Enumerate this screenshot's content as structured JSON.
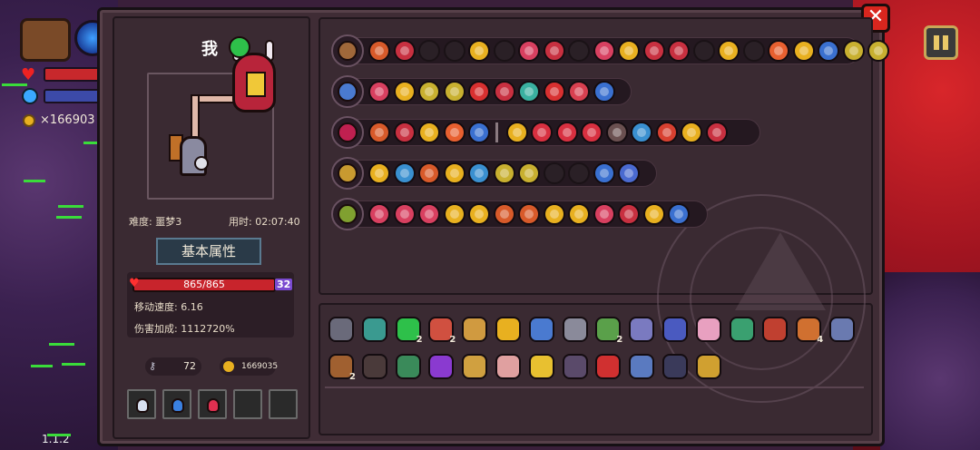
{
  "hud": {
    "gold": "×166903",
    "version": "1.1.2"
  },
  "character": {
    "name": "我",
    "difficulty": "难度: 噩梦3",
    "time_played": "用时: 02:07:40",
    "section_title": "基本属性",
    "hp": "865/865",
    "hp_max_badge": "32",
    "move_speed": "移动速度: 6.16",
    "damage_bonus": "伤害加成: 1112720%",
    "keys": "72",
    "coins": "1669035"
  },
  "colors": {
    "accent": "#c8a858",
    "hp": "#c8242c",
    "close": "#d8261e"
  },
  "card_rows": [
    {
      "weapon_color": "#a0683a",
      "chips": [
        "#d85a2a",
        "#c83040",
        "",
        "",
        "#e8b020",
        "",
        "#d84060",
        "#c83040",
        "",
        "#d84060",
        "#e8b020",
        "#c83040",
        "#c83040",
        "",
        "#e8b020",
        "",
        "#e86030",
        "#e8b020",
        "#3a70d0",
        "#c8b030",
        "#c8b030"
      ]
    },
    {
      "weapon_color": "#4a7ad0",
      "chips": [
        "#d84060",
        "#e8b020",
        "#c8b030",
        "#c8b030",
        "#d83030",
        "#c83040",
        "#3ab0a0",
        "#d83030",
        "#d84050",
        "#3a70d0"
      ]
    },
    {
      "weapon_color": "#c02050",
      "chips": [
        "#d85a2a",
        "#c83040",
        "#e8b020",
        "#e86030",
        "#3a70d0",
        "|",
        "#e8b020",
        "#d83040",
        "#d83040",
        "#d83040",
        "#6a5050",
        "#3a90d0",
        "#d84030",
        "#e8b020",
        "#c83040"
      ]
    },
    {
      "weapon_color": "#c89a30",
      "chips": [
        "#e8b020",
        "#3a90d0",
        "#d85a2a",
        "#e8b020",
        "#3a90d0",
        "#c8b030",
        "#c8b030",
        "",
        "",
        "#3a70d0",
        "#4a6ad0"
      ]
    },
    {
      "weapon_color": "#80a030",
      "chips": [
        "#d84060",
        "#d84060",
        "#d84060",
        "#e8b020",
        "#e8b020",
        "#d85a2a",
        "#d85a2a",
        "#e8b020",
        "#e8b020",
        "#d84060",
        "#c83040",
        "#e8b020",
        "#3a70d0"
      ]
    }
  ],
  "items": {
    "row1": [
      {
        "color": "#6a6a7a",
        "count": ""
      },
      {
        "color": "#3a9a90",
        "count": ""
      },
      {
        "color": "#2ec04a",
        "count": "2"
      },
      {
        "color": "#d05040",
        "count": "2"
      },
      {
        "color": "#d09a40",
        "count": ""
      },
      {
        "color": "#e8b020",
        "count": ""
      },
      {
        "color": "#4a7ad0",
        "count": ""
      },
      {
        "color": "#8a8a9a",
        "count": ""
      },
      {
        "color": "#5aa04a",
        "count": "2"
      },
      {
        "color": "#7a7ac0",
        "count": ""
      },
      {
        "color": "#4a5ac0",
        "count": ""
      },
      {
        "color": "#e8a0c0",
        "count": ""
      },
      {
        "color": "#3aa070",
        "count": ""
      },
      {
        "color": "#c04030",
        "count": ""
      },
      {
        "color": "#d07030",
        "count": "4"
      },
      {
        "color": "#6a7ab0",
        "count": ""
      }
    ],
    "row2": [
      {
        "color": "#a06030",
        "count": "2"
      },
      {
        "color": "#4a3a3a",
        "count": ""
      },
      {
        "color": "#3a8a5a",
        "count": ""
      },
      {
        "color": "#8a3ad0",
        "count": ""
      },
      {
        "color": "#d0a040",
        "count": ""
      },
      {
        "color": "#e0a0a0",
        "count": ""
      },
      {
        "color": "#e8c030",
        "count": ""
      },
      {
        "color": "#5a4a6a",
        "count": ""
      },
      {
        "color": "#d03030",
        "count": ""
      },
      {
        "color": "#5a7ac0",
        "count": ""
      },
      {
        "color": "#3a3a5a",
        "count": ""
      },
      {
        "color": "#d0a030",
        "count": ""
      }
    ]
  }
}
